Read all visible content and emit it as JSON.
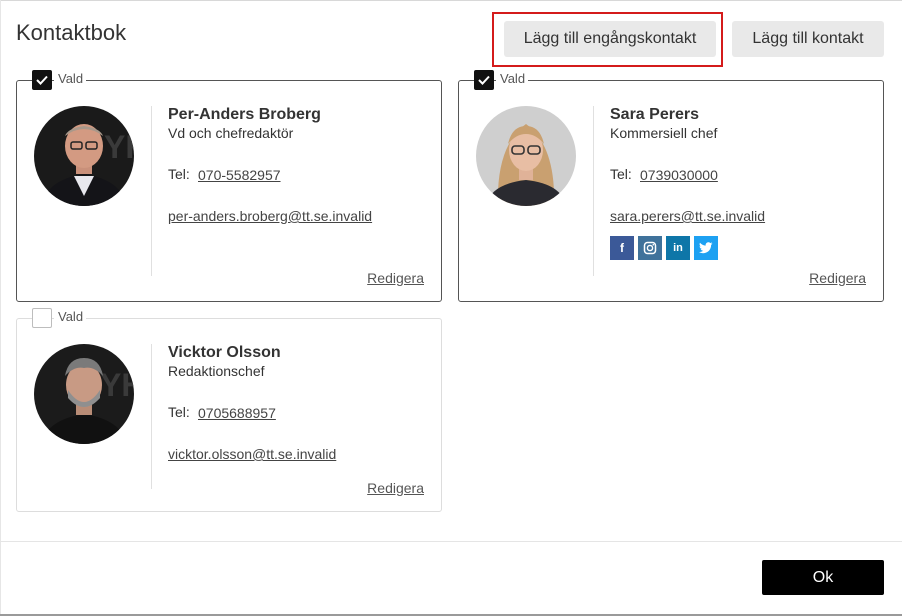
{
  "header": {
    "title": "Kontaktbok",
    "btn_onetime_label": "Lägg till engångskontakt",
    "btn_add_label": "Lägg till kontakt"
  },
  "contacts": [
    {
      "selected": true,
      "select_label": "Vald",
      "name": "Per-Anders Broberg",
      "role": "Vd och chefredaktör",
      "tel_label": "Tel:",
      "phone": "070-5582957",
      "email": "per-anders.broberg@tt.se.invalid",
      "edit_label": "Redigera"
    },
    {
      "selected": true,
      "select_label": "Vald",
      "name": "Sara Perers",
      "role": "Kommersiell chef",
      "tel_label": "Tel:",
      "phone": "0739030000",
      "email": "sara.perers@tt.se.invalid",
      "edit_label": "Redigera",
      "social": [
        {
          "icon": "facebook-icon",
          "glyph": "f",
          "color": "#3b5998"
        },
        {
          "icon": "instagram-icon",
          "glyph": "◙",
          "color": "#3f729b"
        },
        {
          "icon": "linkedin-icon",
          "glyph": "in",
          "color": "#0e76a8"
        },
        {
          "icon": "twitter-icon",
          "glyph": "🐦",
          "color": "#1da1f2"
        }
      ]
    },
    {
      "selected": false,
      "select_label": "Vald",
      "name": "Vicktor Olsson",
      "role": "Redaktionschef",
      "tel_label": "Tel:",
      "phone": "0705688957",
      "email": "vicktor.olsson@tt.se.invalid",
      "edit_label": "Redigera"
    }
  ],
  "footer": {
    "ok_label": "Ok"
  },
  "colors": {
    "highlight": "#d41b1b",
    "button_bg": "#e9e9e9",
    "ok_bg": "#000000"
  }
}
